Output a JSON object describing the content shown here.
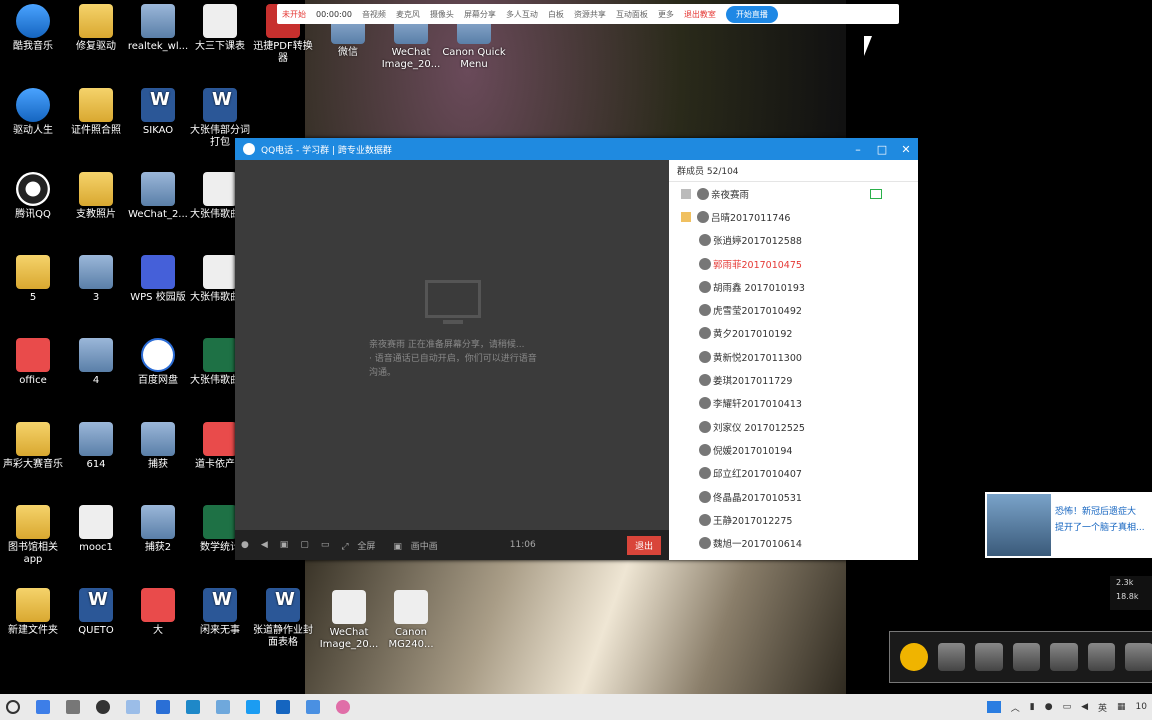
{
  "desktop_icons": [
    {
      "label": "酷我音乐",
      "type": "app"
    },
    {
      "label": "修复驱动",
      "type": "folder"
    },
    {
      "label": "realtek_wl...",
      "type": "img"
    },
    {
      "label": "大三下课表",
      "type": "doc"
    },
    {
      "label": "迅捷PDF转换器",
      "type": "pdf"
    },
    {
      "label": "驱动人生",
      "type": "app"
    },
    {
      "label": "证件照合照",
      "type": "folder"
    },
    {
      "label": "SIKAO",
      "type": "word"
    },
    {
      "label": "大张伟部分词打包",
      "type": "word"
    },
    {
      "label": "腾讯QQ",
      "type": "qq"
    },
    {
      "label": "支教照片",
      "type": "folder"
    },
    {
      "label": "WeChat_2...",
      "type": "img"
    },
    {
      "label": "大张伟歌曲结",
      "type": "doc"
    },
    {
      "label": "5",
      "type": "folder"
    },
    {
      "label": "3",
      "type": "img"
    },
    {
      "label": "WPS 校园版",
      "type": "wps"
    },
    {
      "label": "大张伟歌曲结",
      "type": "doc"
    },
    {
      "label": "office",
      "type": "red"
    },
    {
      "label": "4",
      "type": "img"
    },
    {
      "label": "百度网盘",
      "type": "bd"
    },
    {
      "label": "大张伟歌曲结",
      "type": "excel"
    },
    {
      "label": "声彩大赛音乐",
      "type": "folder"
    },
    {
      "label": "614",
      "type": "img"
    },
    {
      "label": "捕获",
      "type": "img"
    },
    {
      "label": "道卡依产品",
      "type": "red"
    },
    {
      "label": "图书馆相关app",
      "type": "folder"
    },
    {
      "label": "mooc1",
      "type": "doc"
    },
    {
      "label": "捕获2",
      "type": "img"
    },
    {
      "label": "数学统计",
      "type": "excel"
    },
    {
      "label": "新建文件夹",
      "type": "folder"
    },
    {
      "label": "QUETO",
      "type": "word"
    },
    {
      "label": "大",
      "type": "red"
    },
    {
      "label": "闲来无事",
      "type": "word"
    },
    {
      "label": "张道静作业封面表格",
      "type": "word"
    }
  ],
  "center_icons": [
    {
      "label": "微信",
      "type": "img"
    },
    {
      "label": "WeChat Image_20...",
      "type": "img"
    },
    {
      "label": "Canon Quick Menu",
      "type": "img"
    },
    {
      "label": "WeChat Image_20...",
      "type": "doc"
    },
    {
      "label": "Canon MG240...",
      "type": "doc"
    }
  ],
  "toolbar": {
    "live": "未开始",
    "timer": "00:00:00",
    "items": [
      "音视频",
      "麦克风",
      "摄像头",
      "屏幕分享",
      "多人互动",
      "白板",
      "资源共享",
      "互动面板",
      "更多"
    ],
    "exit": "退出教室",
    "start": "开始直播"
  },
  "qq_window": {
    "title": "QQ电话 - 学习群 | 跨专业数据群",
    "stage_message": "亲夜赛雨 正在准备屏幕分享，请稍候...",
    "stage_note": "· 语音通话已自动开启，你们可以进行语音沟通。",
    "controls": {
      "fullscreen": "全屏",
      "picture_in_picture": "画中画",
      "signal": "11:06",
      "exit": "退出"
    },
    "members_header": "群成员 52/104",
    "members": [
      {
        "name": "亲夜赛雨",
        "red": false
      },
      {
        "name": "吕晴2017011746",
        "red": false
      },
      {
        "name": "张逍婷2017012588",
        "red": false
      },
      {
        "name": "郭雨菲2017010475",
        "red": true
      },
      {
        "name": "胡雨鑫 2017010193",
        "red": false
      },
      {
        "name": "虎雪莹2017010492",
        "red": false
      },
      {
        "name": "黄夕2017010192",
        "red": false
      },
      {
        "name": "黄新悦2017011300",
        "red": false
      },
      {
        "name": "姜琪2017011729",
        "red": false
      },
      {
        "name": "李耀轩2017010413",
        "red": false
      },
      {
        "name": "刘家仪 2017012525",
        "red": false
      },
      {
        "name": "倪媛2017010194",
        "red": false
      },
      {
        "name": "邱立红2017010407",
        "red": false
      },
      {
        "name": "佟晶晶2017010531",
        "red": false
      },
      {
        "name": "王静2017012275",
        "red": false
      },
      {
        "name": "魏旭一2017010614",
        "red": false
      }
    ]
  },
  "news_popup": {
    "line1": "恐怖！新冠后遗症大",
    "line2": "提开了一个脑子真相..."
  },
  "netspeed": {
    "up": "2.3k",
    "down": "18.8k"
  },
  "taskbar": {
    "lang": "英",
    "time": "10"
  },
  "colors": {
    "qq_blue": "#1f8ae0",
    "accent_red": "#e53935",
    "start_blue": "#1e88e5"
  }
}
